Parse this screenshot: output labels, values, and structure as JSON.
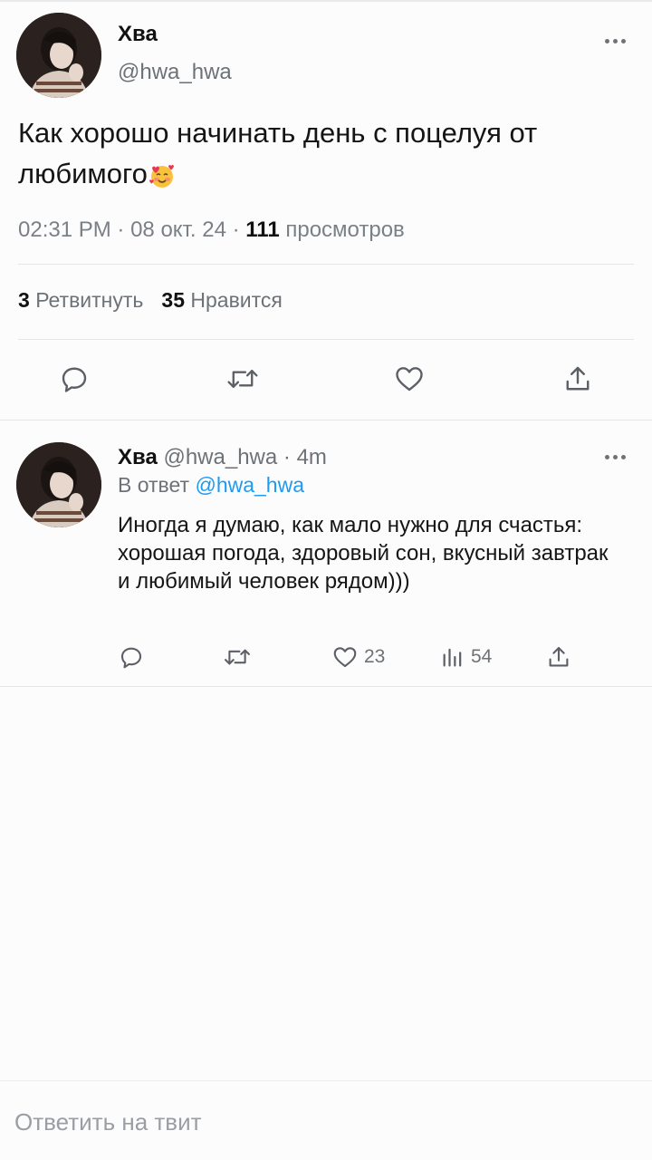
{
  "main_tweet": {
    "author_name": "Хва",
    "author_handle": "@hwa_hwa",
    "text": "Как хорошо начинать день с поцелуя от любимого",
    "emoji": "smiling-face-with-hearts",
    "time": "02:31 PM",
    "date": "08 окт. 24",
    "separator": "·",
    "views_count": "111",
    "views_label": "просмотров",
    "retweets_count": "3",
    "retweets_label": "Ретвитнуть",
    "likes_count": "35",
    "likes_label": "Нравится"
  },
  "reply_tweet": {
    "author_name": "Хва",
    "author_handle": "@hwa_hwa",
    "separator": "·",
    "time_ago": "4m",
    "in_reply_prefix": "В ответ",
    "in_reply_mention": "@hwa_hwa",
    "text": "Иногда я думаю, как мало нужно для счастья: хорошая погода, здоровый сон, вкусный завтрак и любимый человек рядом)))",
    "likes_count": "23",
    "views_count": "54"
  },
  "compose": {
    "placeholder": "Ответить на твит"
  },
  "colors": {
    "background": "#fdfcfd",
    "text": "#111111",
    "secondary": "#6d7277",
    "link": "#1d9bf0",
    "icon": "#5c6066"
  }
}
